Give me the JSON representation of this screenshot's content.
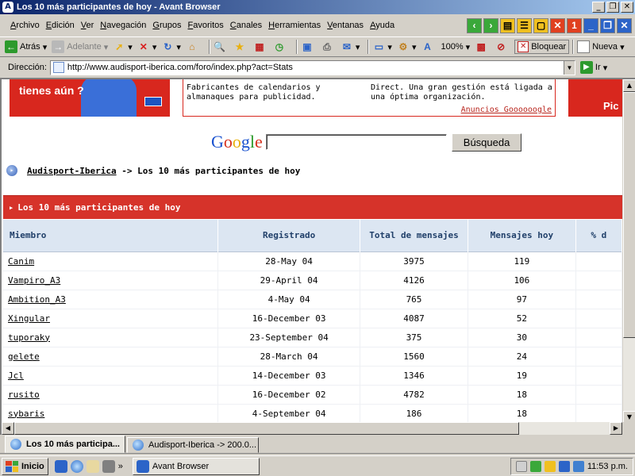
{
  "window": {
    "title": "Los 10 más participantes de hoy - Avant Browser"
  },
  "menu": {
    "items": [
      "Archivo",
      "Edición",
      "Ver",
      "Navegación",
      "Grupos",
      "Favoritos",
      "Canales",
      "Herramientas",
      "Ventanas",
      "Ayuda"
    ]
  },
  "toolbar": {
    "back": "Atrás",
    "forward": "Adelante",
    "zoom": "100%",
    "block": "Bloquear",
    "new": "Nueva"
  },
  "address": {
    "label": "Dirección:",
    "url": "http://www.audisport-iberica.com/foro/index.php?act=Stats",
    "go": "Ir"
  },
  "ads": {
    "left_text": "tienes aún ?",
    "col1": "Fabricantes de calendarios y almanaques para publicidad.",
    "col2": "Direct. Una gran gestión está ligada a una óptima organización.",
    "link": "Anuncios Goooooogle",
    "right_text": "Pic"
  },
  "search": {
    "button": "Búsqueda",
    "logo": [
      "G",
      "o",
      "o",
      "g",
      "l",
      "e"
    ]
  },
  "breadcrumb": {
    "link": "Audisport-Iberica",
    "current": "-> Los 10 más participantes de hoy"
  },
  "section": {
    "title": "Los 10 más participantes de hoy"
  },
  "table": {
    "headers": {
      "member": "Miembro",
      "registered": "Registrado",
      "total": "Total de mensajes",
      "today": "Mensajes hoy",
      "pct": "% d"
    },
    "rows": [
      {
        "member": "Canim",
        "registered": "28-May 04",
        "total": "3975",
        "today": "119"
      },
      {
        "member": "Vampiro_A3",
        "registered": "29-April 04",
        "total": "4126",
        "today": "106"
      },
      {
        "member": "Ambition_A3",
        "registered": "4-May 04",
        "total": "765",
        "today": "97"
      },
      {
        "member": "Xingular",
        "registered": "16-December 03",
        "total": "4087",
        "today": "52"
      },
      {
        "member": "tuporaky",
        "registered": "23-September 04",
        "total": "375",
        "today": "30"
      },
      {
        "member": "gelete",
        "registered": "28-March 04",
        "total": "1560",
        "today": "24"
      },
      {
        "member": "Jcl",
        "registered": "14-December 03",
        "total": "1346",
        "today": "19"
      },
      {
        "member": "rusito",
        "registered": "16-December 02",
        "total": "4782",
        "today": "18"
      },
      {
        "member": "sybaris",
        "registered": "4-September 04",
        "total": "186",
        "today": "18"
      }
    ]
  },
  "tabs": [
    "Los 10 más participa...",
    "Audisport-Iberica -> 200.0..."
  ],
  "taskbar": {
    "start": "Inicio",
    "task": "Avant Browser",
    "clock": "11:53 p.m.",
    "ql_chevron": "»"
  },
  "colors": {
    "accent_red": "#d6332a",
    "header_blue": "#dce6f2",
    "title_blue": "#0a246a"
  }
}
